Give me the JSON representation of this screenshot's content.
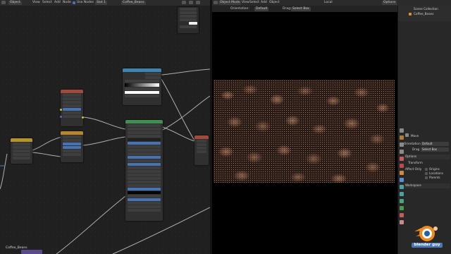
{
  "topbar": {
    "node_editor": {
      "editor_type": "Object",
      "menus": [
        "View",
        "Select",
        "Add",
        "Node"
      ],
      "use_nodes_label": "Use Nodes",
      "slot": "Slot 1",
      "material_name": "Coffee_Beans"
    },
    "viewport": {
      "mode": "Object Mode",
      "menus": [
        "View",
        "Select",
        "Add",
        "Object"
      ],
      "orientation_label": "Orientation:",
      "orientation_value": "Default",
      "drag_label": "Drag:",
      "drag_value": "Select Box",
      "transform": "Local",
      "options": "Options"
    }
  },
  "node_editor": {
    "bottom_label": "Coffee_Beans"
  },
  "properties": {
    "scene_collection": "Scene Collection",
    "object_name": "Coffee_Beans",
    "tool_name": "Move",
    "orientation_label": "Orientation",
    "orientation_value": "Default",
    "drag_label": "Drag",
    "drag_value": "Select Box",
    "options_header": "Options",
    "transform_header": "Transform",
    "affect_only_label": "Affect Only",
    "affect_items": [
      "Origins",
      "Locations",
      "Parents"
    ],
    "workspace_header": "Workspace"
  },
  "logo": {
    "text": "blender guy"
  },
  "colors": {
    "node_header_principled": "#3f8f4e",
    "node_header_texture": "#b8862e",
    "node_header_color": "#b5942c",
    "node_header_converter": "#3f84b0",
    "node_header_shader": "#a04a3b",
    "selection_blue": "#4772b3",
    "logo_orange": "#f08a1c"
  }
}
